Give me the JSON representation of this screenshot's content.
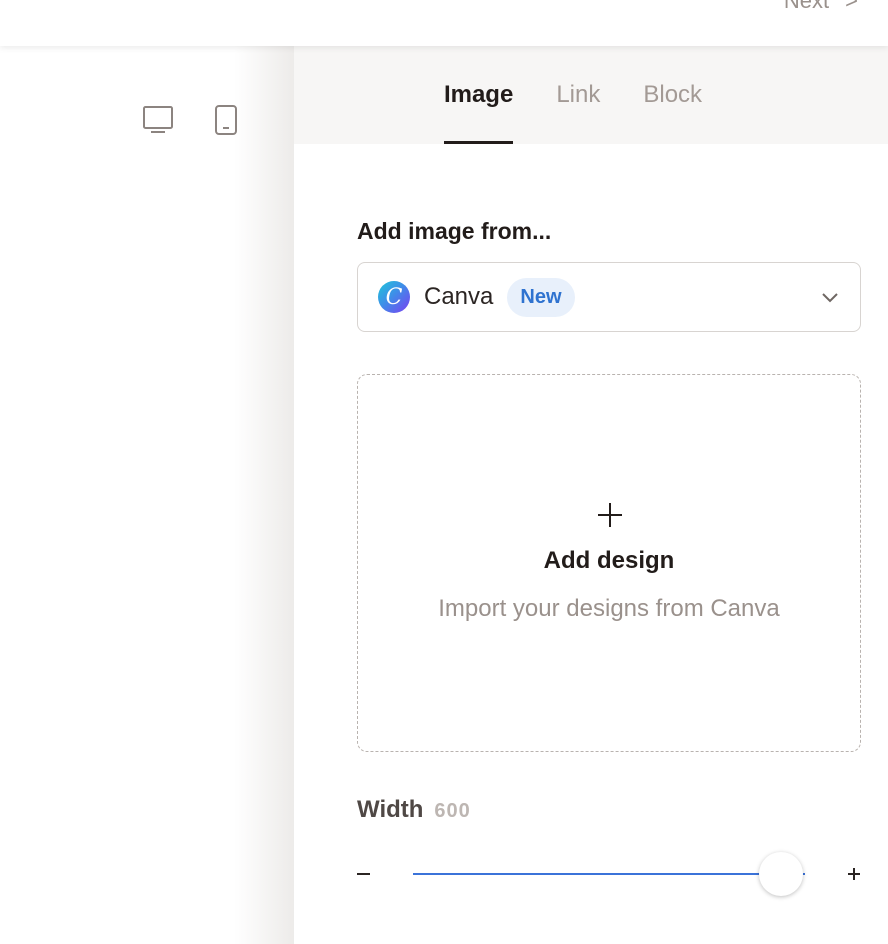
{
  "topbar": {
    "next_label": "Next",
    "next_arrow": ">"
  },
  "preview": {
    "device_icons": [
      "desktop-icon",
      "mobile-icon"
    ]
  },
  "tabs": [
    {
      "label": "Image",
      "active": true
    },
    {
      "label": "Link",
      "active": false
    },
    {
      "label": "Block",
      "active": false
    }
  ],
  "image_source": {
    "label": "Add image from...",
    "selected": "Canva",
    "logo_letter": "C",
    "badge": "New"
  },
  "dropzone": {
    "title": "Add design",
    "subtitle": "Import your designs from Canva"
  },
  "width": {
    "label": "Width",
    "value": "600",
    "slider_fraction": 0.94
  },
  "colors": {
    "accent": "#3b73d9",
    "badge_bg": "#e8f0fb",
    "badge_text": "#2f73d0",
    "tab_bar_bg": "#f7f6f5"
  }
}
